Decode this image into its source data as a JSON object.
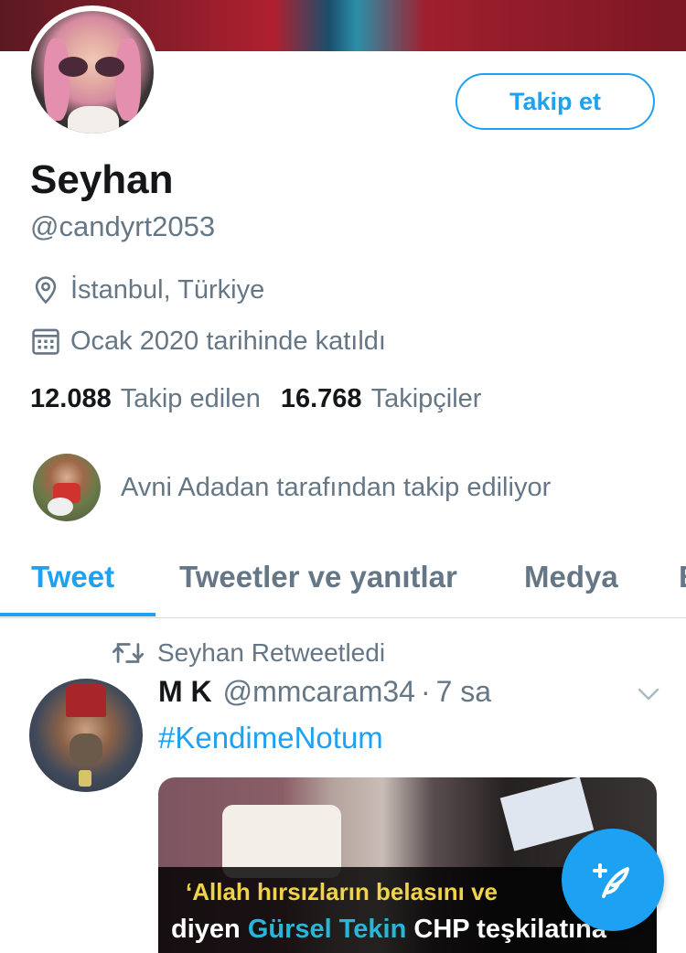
{
  "profile": {
    "follow_label": "Takip et",
    "name": "Seyhan",
    "handle": "@candyrt2053",
    "location": "İstanbul, Türkiye",
    "joined": "Ocak 2020 tarihinde katıldı",
    "following_count": "12.088",
    "following_label": "Takip edilen",
    "followers_count": "16.768",
    "followers_label": "Takipçiler",
    "followed_by": "Avni Adadan tarafından takip ediliyor"
  },
  "tabs": [
    {
      "label": "Tweet",
      "active": true
    },
    {
      "label": "Tweetler ve yanıtlar",
      "active": false
    },
    {
      "label": "Medya",
      "active": false
    },
    {
      "label": "B",
      "active": false
    }
  ],
  "tweet": {
    "retweet_label": "Seyhan Retweetledi",
    "author_name": "M K",
    "author_handle": "@mmcaram34",
    "separator": "·",
    "time": "7 sa",
    "text": "#KendimeNotum",
    "media_caption_line1": "‘Allah hırsızların belasını ve",
    "media_caption_line2_pre": "diyen ",
    "media_caption_line2_highlight": "Gürsel Tekin",
    "media_caption_line2_post": " CHP teşkilatına"
  },
  "icons": {
    "location": "location-pin-icon",
    "calendar": "calendar-icon",
    "retweet": "retweet-icon",
    "chevron": "chevron-down-icon",
    "compose": "compose-tweet-icon"
  },
  "colors": {
    "accent": "#1da1f2",
    "text_primary": "#14171a",
    "text_secondary": "#657786",
    "divider": "#d5dce1"
  }
}
